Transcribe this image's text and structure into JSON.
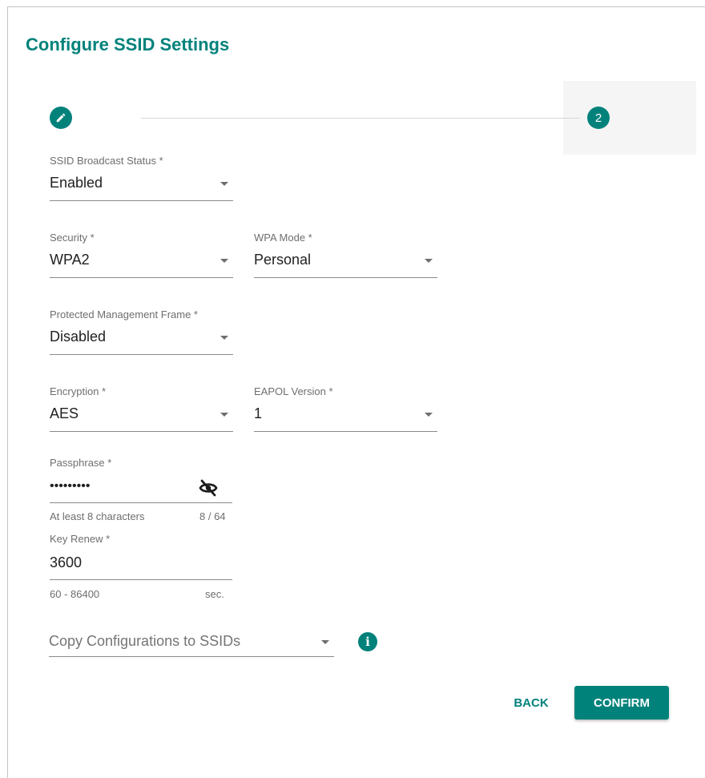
{
  "dialog": {
    "title": "Configure SSID Settings"
  },
  "stepper": {
    "step2_label": "2"
  },
  "fields": {
    "ssid_broadcast": {
      "label": "SSID Broadcast Status *",
      "value": "Enabled"
    },
    "security": {
      "label": "Security *",
      "value": "WPA2"
    },
    "wpa_mode": {
      "label": "WPA Mode *",
      "value": "Personal"
    },
    "pmf": {
      "label": "Protected Management Frame *",
      "value": "Disabled"
    },
    "encryption": {
      "label": "Encryption *",
      "value": "AES"
    },
    "eapol": {
      "label": "EAPOL Version *",
      "value": "1"
    },
    "passphrase": {
      "label": "Passphrase *",
      "value": "•••••••••",
      "hint": "At least 8 characters",
      "counter": "8 / 64"
    },
    "key_renew": {
      "label": "Key Renew *",
      "value": "3600",
      "hint": "60 - 86400",
      "unit": "sec."
    },
    "copy_config": {
      "placeholder": "Copy Configurations to SSIDs"
    }
  },
  "actions": {
    "back": "BACK",
    "confirm": "CONFIRM"
  },
  "icons": {
    "step1": "edit-icon",
    "passphrase_toggle": "eye-off-icon",
    "info": "info-icon"
  },
  "colors": {
    "accent": "#00827b"
  }
}
